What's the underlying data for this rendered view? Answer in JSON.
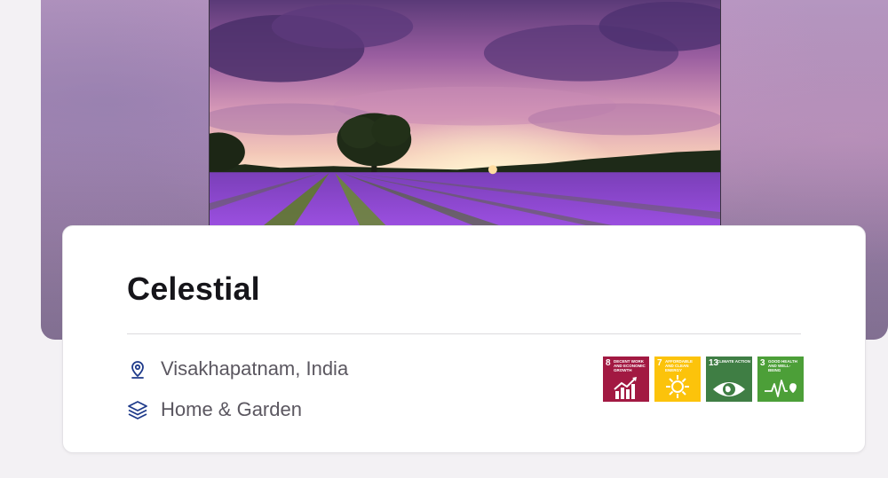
{
  "project": {
    "title": "Celestial",
    "location": "Visakhapatnam, India",
    "category": "Home & Garden"
  },
  "sdgs": [
    {
      "number": "8",
      "label": "DECENT WORK AND ECONOMIC GROWTH",
      "color": "#a21942",
      "icon": "growth-chart-icon"
    },
    {
      "number": "7",
      "label": "AFFORDABLE AND CLEAN ENERGY",
      "color": "#fcc30b",
      "icon": "sun-icon"
    },
    {
      "number": "13",
      "label": "CLIMATE ACTION",
      "color": "#3f7e44",
      "icon": "eye-globe-icon"
    },
    {
      "number": "3",
      "label": "GOOD HEALTH AND WELL-BEING",
      "color": "#4c9f38",
      "icon": "heartbeat-icon"
    }
  ],
  "colors": {
    "accent": "#1e3a8a",
    "title": "#16151a",
    "meta_text": "#5b5760"
  },
  "icons": {
    "location": "map-pin-icon",
    "category": "layers-icon"
  }
}
